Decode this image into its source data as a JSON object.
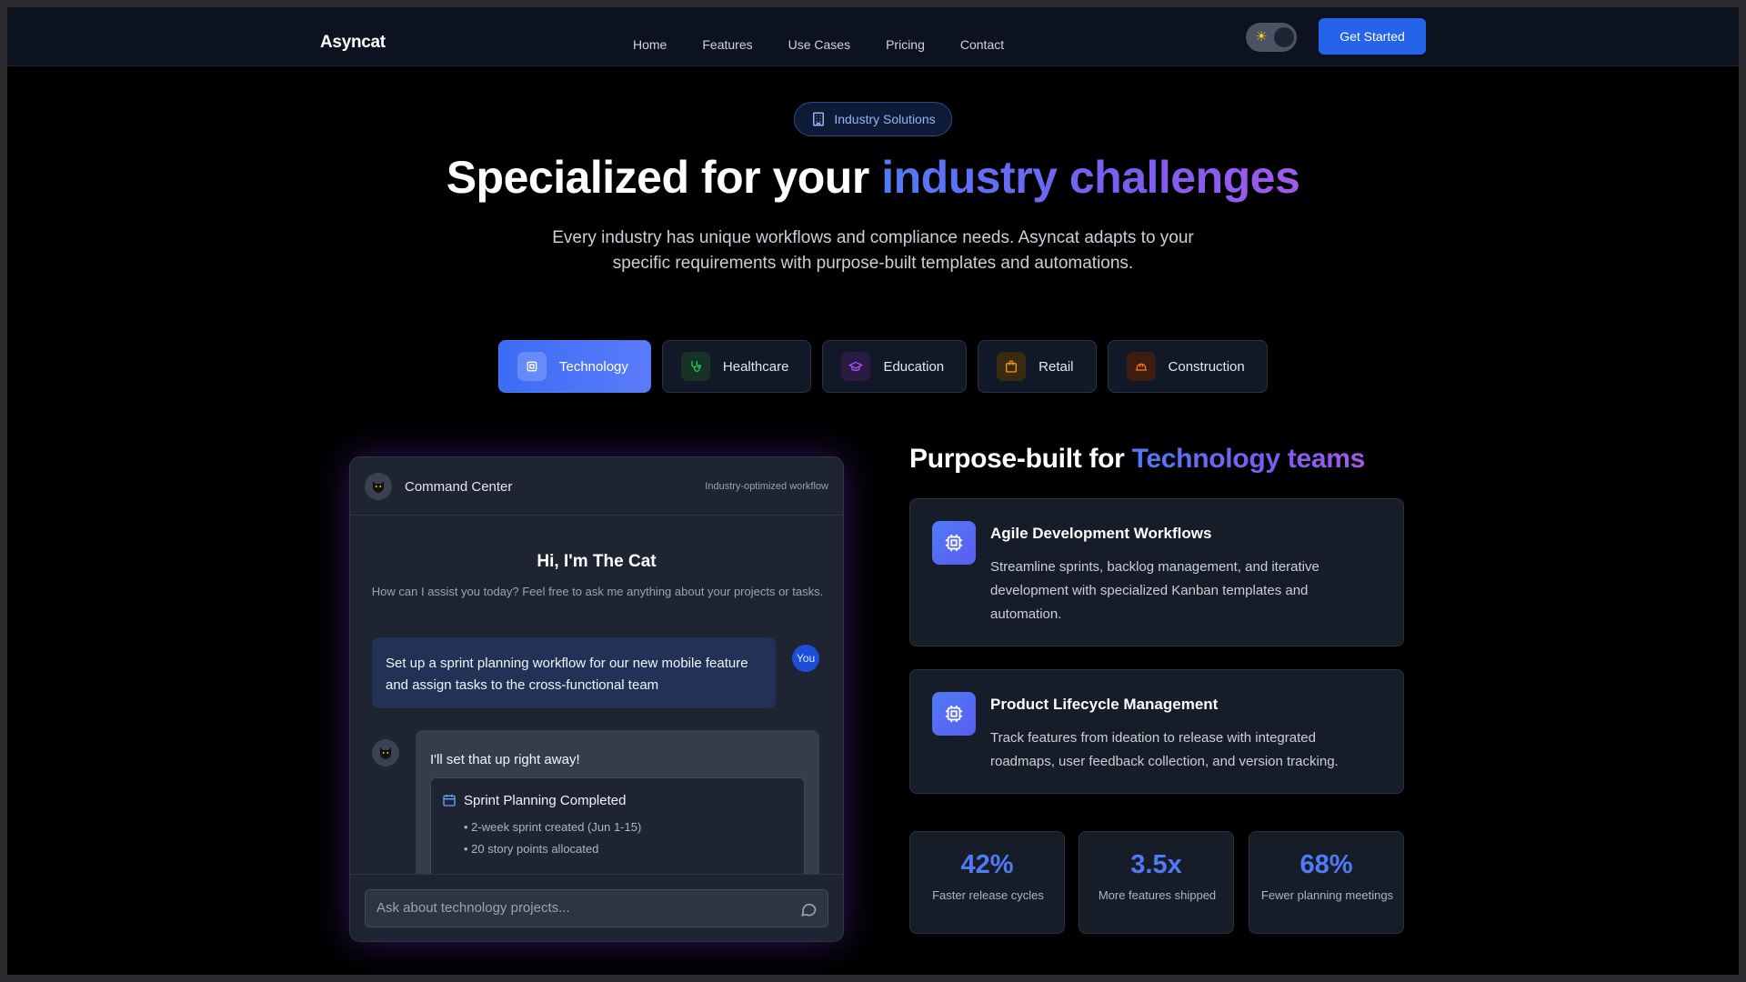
{
  "nav": {
    "brand": "Asyncat",
    "links": [
      "Home",
      "Features",
      "Use Cases",
      "Pricing",
      "Contact"
    ],
    "cta": "Get Started",
    "theme_toggle_icon": "sun-icon"
  },
  "hero": {
    "badge": "Industry Solutions",
    "title_plain": "Specialized for your",
    "title_accent": "industry challenges",
    "subtitle": "Every industry has unique workflows and compliance needs. Asyncat adapts to your specific requirements with purpose-built templates and automations."
  },
  "tabs": [
    {
      "label": "Technology",
      "icon": "chip-icon",
      "color": "#ffffff",
      "active": true
    },
    {
      "label": "Healthcare",
      "icon": "stethoscope-icon",
      "color": "#22c55e",
      "active": false
    },
    {
      "label": "Education",
      "icon": "graduation-cap-icon",
      "color": "#a855f7",
      "active": false
    },
    {
      "label": "Retail",
      "icon": "shopping-bag-icon",
      "color": "#f59e0b",
      "active": false
    },
    {
      "label": "Construction",
      "icon": "hard-hat-icon",
      "color": "#f97316",
      "active": false
    }
  ],
  "chat": {
    "title": "Command Center",
    "subtitle": "Industry-optimized workflow",
    "greeting": "Hi, I'm The Cat",
    "greeting_sub": "How can I assist you today? Feel free to ask me anything about your projects or tasks.",
    "user_message": "Set up a sprint planning workflow for our new mobile feature and assign tasks to the cross-functional team",
    "user_label": "You",
    "bot_reply": "I'll set that up right away!",
    "task_title": "Sprint Planning Completed",
    "task_items": [
      "• 2-week sprint created (Jun 1-15)",
      "• 20 story points allocated"
    ],
    "input_placeholder": "Ask about technology projects..."
  },
  "features": {
    "heading_plain": "Purpose-built for",
    "heading_accent": "Technology teams",
    "cards": [
      {
        "title": "Agile Development Workflows",
        "desc": "Streamline sprints, backlog management, and iterative development with specialized Kanban templates and automation."
      },
      {
        "title": "Product Lifecycle Management",
        "desc": "Track features from ideation to release with integrated roadmaps, user feedback collection, and version tracking."
      }
    ],
    "stats": [
      {
        "value": "42%",
        "label": "Faster release cycles"
      },
      {
        "value": "3.5x",
        "label": "More features shipped"
      },
      {
        "value": "68%",
        "label": "Fewer planning meetings"
      }
    ]
  },
  "colors": {
    "accent": "#2563eb",
    "gradient_start": "#4f7bf7",
    "gradient_end": "#a25aeb"
  }
}
